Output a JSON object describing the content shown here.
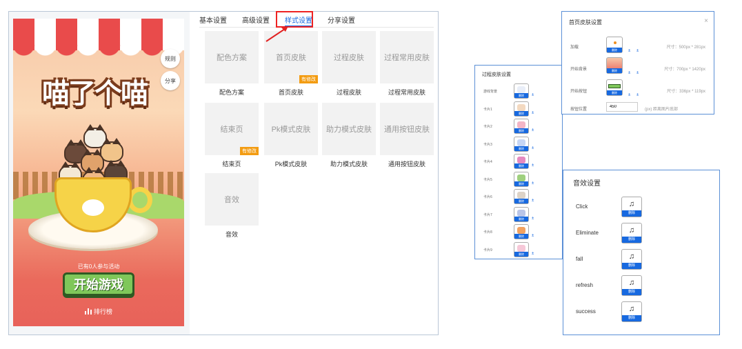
{
  "preview": {
    "rules_label": "规则",
    "share_label": "分享",
    "game_title": "喵了个喵",
    "participants": "已有0人参与活动",
    "start_button": "开始游戏",
    "rank_label": "排行榜"
  },
  "tabs": [
    {
      "label": "基本设置"
    },
    {
      "label": "高级设置"
    },
    {
      "label": "样式设置"
    },
    {
      "label": "分享设置"
    }
  ],
  "modified_badge": "有修改",
  "cards": [
    {
      "label": "配色方案",
      "caption": "配色方案",
      "modified": false
    },
    {
      "label": "首页皮肤",
      "caption": "首页皮肤",
      "modified": true
    },
    {
      "label": "过程皮肤",
      "caption": "过程皮肤",
      "modified": false
    },
    {
      "label": "过程常用皮肤",
      "caption": "过程常用皮肤",
      "modified": false
    },
    {
      "label": "结束页",
      "caption": "结束页",
      "modified": true
    },
    {
      "label": "Pk模式皮肤",
      "caption": "Pk模式皮肤",
      "modified": false
    },
    {
      "label": "助力模式皮肤",
      "caption": "助力模式皮肤",
      "modified": false
    },
    {
      "label": "通用按钮皮肤",
      "caption": "通用按钮皮肤",
      "modified": false
    },
    {
      "label": "音效",
      "caption": "音效",
      "modified": false
    }
  ],
  "process_skin": {
    "title": "过程皮肤设置",
    "rows": [
      "游戏背景",
      "卡片1",
      "卡片2",
      "卡片3",
      "卡片4",
      "卡片5",
      "卡片6",
      "卡片7",
      "卡片8",
      "卡片9"
    ],
    "delete_label": "删除"
  },
  "home_skin": {
    "title": "首页皮肤设置",
    "close": "×",
    "rows": [
      {
        "label": "加载",
        "size": "尺寸：500px * 281px"
      },
      {
        "label": "开始背景",
        "size": "尺寸：700px * 1420px"
      },
      {
        "label": "开始按钮",
        "size": "尺寸：336px * 119px"
      }
    ],
    "button_position_label": "按钮位置",
    "button_position_value": "450",
    "button_position_hint": "(px) 距离图片底部",
    "delete_label": "删除"
  },
  "sound": {
    "title": "音效设置",
    "items": [
      "Click",
      "Eliminate",
      "fall",
      "refresh",
      "success"
    ],
    "delete_label": "删除"
  },
  "colors": {
    "accent": "#1769e0",
    "badge": "#f39c12",
    "highlight": "#e22222"
  }
}
